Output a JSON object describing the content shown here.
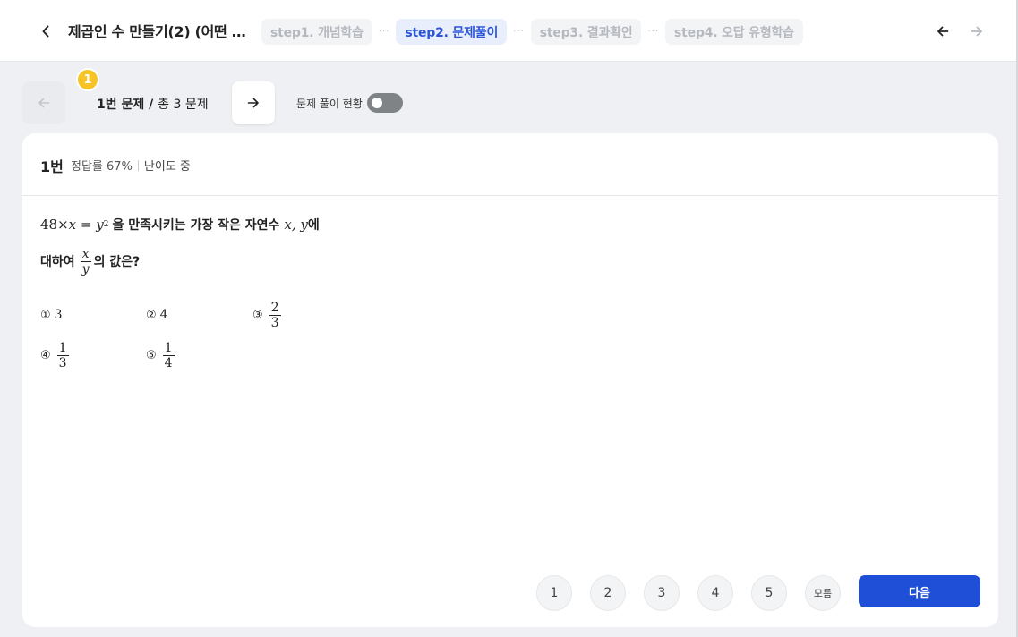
{
  "header": {
    "title": "제곱인 수 만들기(2) (어떤 …",
    "steps": [
      {
        "label": "step1. 개념학습",
        "active": false
      },
      {
        "label": "step2. 문제풀이",
        "active": true
      },
      {
        "label": "step3. 결과확인",
        "active": false
      },
      {
        "label": "step4. 오답 유형학습",
        "active": false
      }
    ],
    "separator": "···"
  },
  "question_nav": {
    "badge": "1",
    "current": "1번 문제",
    "divider": " / ",
    "total": "총 3 문제",
    "status_label": "문제 풀이 현황",
    "status_toggle_on": false
  },
  "question": {
    "number": "1번",
    "accuracy": "정답률 67%",
    "difficulty": "난이도 중",
    "stem": {
      "lead_num": "48",
      "times": "×",
      "var_x": "x",
      "equals": " = ",
      "var_y": "y",
      "exponent": "2",
      "text1": "을 만족시키는 가장 작은 자연수",
      "vars": "x, y",
      "text2": "에",
      "text3": "대하여",
      "frac_num": "x",
      "frac_den": "y",
      "text4": "의 값은?"
    },
    "choices": [
      {
        "mark": "①",
        "value": "3"
      },
      {
        "mark": "②",
        "value": "4"
      },
      {
        "mark": "③",
        "num": "2",
        "den": "3"
      },
      {
        "mark": "④",
        "num": "1",
        "den": "3"
      },
      {
        "mark": "⑤",
        "num": "1",
        "den": "4"
      }
    ]
  },
  "answer_buttons": [
    "1",
    "2",
    "3",
    "4",
    "5",
    "모름"
  ],
  "next_button": "다음",
  "colors": {
    "accent": "#1f4fd6",
    "badge": "#f7c325",
    "active_step_bg": "#e8eefc",
    "active_step_text": "#2b55d6",
    "background": "#eef0f3"
  }
}
